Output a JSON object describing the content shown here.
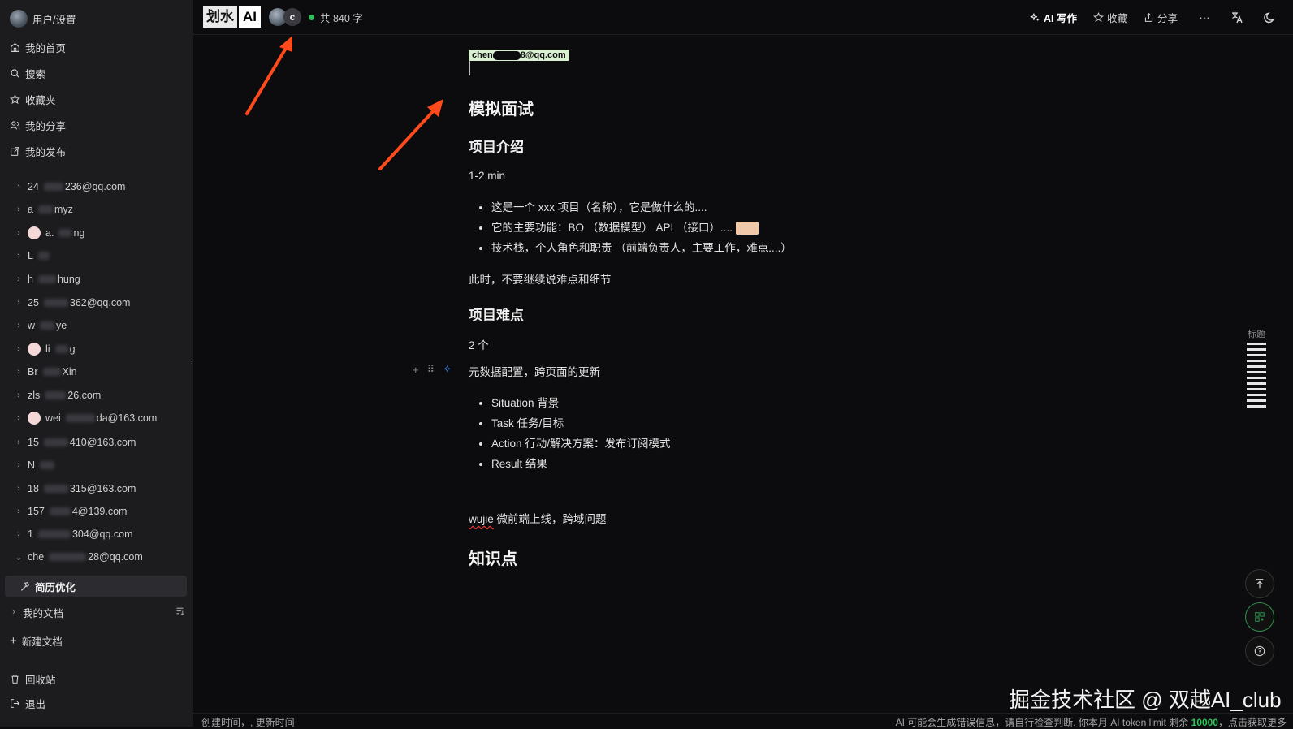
{
  "sidebar": {
    "user_label": "用户/设置",
    "nav": [
      {
        "label": "我的首页",
        "icon": "home-icon"
      },
      {
        "label": "搜索",
        "icon": "search-icon"
      },
      {
        "label": "收藏夹",
        "icon": "star-icon"
      },
      {
        "label": "我的分享",
        "icon": "users-icon"
      },
      {
        "label": "我的发布",
        "icon": "external-link-icon"
      }
    ],
    "tree": [
      {
        "text": "24",
        "text2": "236@qq.com",
        "avatar": false,
        "blur_w": 24
      },
      {
        "text": "a",
        "text2": "myz",
        "avatar": false,
        "blur_w": 18
      },
      {
        "text": "a.",
        "text2": "ng",
        "avatar": true,
        "blur_w": 16
      },
      {
        "text": "L",
        "text2": "",
        "avatar": false,
        "blur_w": 14
      },
      {
        "text": "h",
        "text2": "hung",
        "avatar": false,
        "blur_w": 22
      },
      {
        "text": "25",
        "text2": "362@qq.com",
        "avatar": false,
        "blur_w": 30
      },
      {
        "text": "w",
        "text2": "ye",
        "avatar": false,
        "blur_w": 18
      },
      {
        "text": "li",
        "text2": "g",
        "avatar": true,
        "blur_w": 16
      },
      {
        "text": "Br",
        "text2": "Xin",
        "avatar": false,
        "blur_w": 22
      },
      {
        "text": "zls",
        "text2": "26.com",
        "avatar": false,
        "blur_w": 26
      },
      {
        "text": "wei",
        "text2": "da@163.com",
        "avatar": true,
        "blur_w": 36
      },
      {
        "text": "15",
        "text2": "410@163.com",
        "avatar": false,
        "blur_w": 30
      },
      {
        "text": "N",
        "text2": "",
        "avatar": false,
        "blur_w": 18
      },
      {
        "text": "18",
        "text2": "315@163.com",
        "avatar": false,
        "blur_w": 30
      },
      {
        "text": "157",
        "text2": "4@139.com",
        "avatar": false,
        "blur_w": 26
      },
      {
        "text": "1",
        "text2": "304@qq.com",
        "avatar": false,
        "blur_w": 40
      },
      {
        "text": "che",
        "text2": "28@qq.com",
        "avatar": false,
        "blur_w": 46
      }
    ],
    "active_doc": "简历优化",
    "my_docs": "我的文档",
    "new_doc": "新建文档",
    "trash": "回收站",
    "logout": "退出"
  },
  "header": {
    "logo_cn": "划水",
    "logo_ai": "AI",
    "collab_initial": "c",
    "word_count": "共 840 字",
    "ai_write": "AI 写作",
    "favorite": "收藏",
    "share": "分享",
    "more": "···"
  },
  "doc": {
    "email_tag_left": "chen",
    "email_tag_right": "8@qq.com",
    "h1": "模拟面试",
    "s1_title": "项目介绍",
    "s1_time": "1-2 min",
    "s1_bullets": [
      "这是一个 xxx 项目（名称），它是做什么的....",
      "它的主要功能：BO （数据模型） API （接口）....",
      "技术栈，个人角色和职责 （前端负责人，主要工作，难点....）"
    ],
    "s1_note": "此时，不要继续说难点和细节",
    "s2_title": "项目难点",
    "s2_count": "2 个",
    "s2_item": "元数据配置，跨页面的更新",
    "s2_bullets": [
      "Situation 背景",
      "Task 任务/目标",
      "Action 行动/解决方案：发布订阅模式",
      "Result 结果"
    ],
    "s2_wujie": "wujie",
    "s2_wujie_rest": " 微前端上线，跨域问题",
    "s3_title": "知识点"
  },
  "toc_label": "标题",
  "watermark": "掘金技术社区 @ 双越AI_club",
  "status": {
    "left": "创建时间，, 更新时间",
    "right_prefix": "AI 可能会生成错误信息，请自行检查判断. 你本月 AI token limit 剩余 ",
    "right_num": "10000",
    "right_suffix": "，点击获取更多"
  }
}
